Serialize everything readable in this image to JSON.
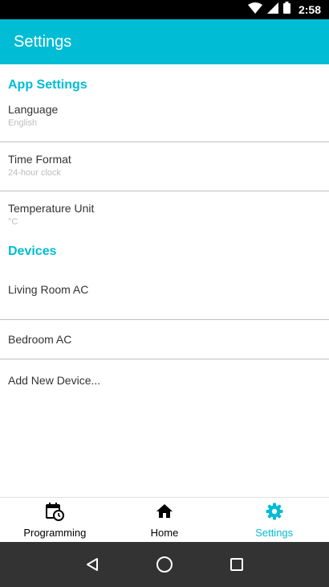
{
  "status_bar": {
    "time": "2:58"
  },
  "app_bar": {
    "title": "Settings"
  },
  "app_settings": {
    "header": "App Settings",
    "items": [
      {
        "label": "Language",
        "value": "English"
      },
      {
        "label": "Time Format",
        "value": "24-hour clock"
      },
      {
        "label": "Temperature Unit",
        "value": "°C"
      }
    ]
  },
  "devices": {
    "header": "Devices",
    "items": [
      {
        "label": "Living Room AC"
      },
      {
        "label": "Bedroom AC"
      },
      {
        "label": "Add New Device..."
      }
    ]
  },
  "bottom_nav": {
    "items": [
      {
        "label": "Programming",
        "icon": "calendar-clock-icon"
      },
      {
        "label": "Home",
        "icon": "home-icon"
      },
      {
        "label": "Settings",
        "icon": "gear-icon",
        "active": true
      }
    ]
  },
  "colors": {
    "accent": "#00bcd4"
  }
}
